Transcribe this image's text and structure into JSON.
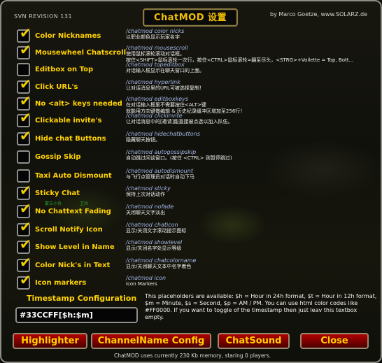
{
  "window": {
    "title": "ChatMOD 设置",
    "credit": "by Marco Goetze, www.SOLARZ.de",
    "revision": "SVN REVISION 131"
  },
  "options": [
    {
      "label": "Color Nicknames",
      "checked": true,
      "cmd": "/chatmod color nicks",
      "desc": "以职业颜色显示玩家名字"
    },
    {
      "label": "Mousewheel Chatscroll",
      "checked": true,
      "cmd": "/chatmod mousescroll",
      "desc": "使用鼠标滚轮滚动对话框。\n按住<SHIFT>鼠标滚轮一次行，按住<CTRL>鼠标滚轮=翻至尽头，<STRG>+Voilette = Top, Bott..."
    },
    {
      "label": "Editbox on Top",
      "checked": false,
      "cmd": "/chatmod topeditbox",
      "desc": "对话输入框显示在聊天窗口的上面。"
    },
    {
      "label": "Click URL's",
      "checked": true,
      "cmd": "/chatmod hyperlink",
      "desc": "让对话消息里的URL可被选择复制！"
    },
    {
      "label": "No <alt> keys needed",
      "checked": true,
      "cmd": "/chatmod editboxkeys",
      "desc": "在对话输入框里不需要按住<ALT>键\n就能用方向键做编辑 & 历史纪录缓冲区增加至256行！"
    },
    {
      "label": "Clickable invite's",
      "checked": true,
      "cmd": "/chatmod clickinvite",
      "desc": "让对话消息中的[邀请]能直接被点选以加入队伍。"
    },
    {
      "label": "Hide chat Buttons",
      "checked": true,
      "cmd": "/chatmod hidechatbuttons",
      "desc": "隐藏聊天按钮。"
    },
    {
      "label": "Gossip Skip",
      "checked": false,
      "cmd": "/chatmod autogossipskip",
      "desc": "自动跳过闲谈窗口。(按住 <CTRL> 则暂停跳过)"
    },
    {
      "label": "Taxi Auto Dismount",
      "checked": false,
      "cmd": "/chatmod autodismount",
      "desc": "与飞行点管理员对话时自动下马"
    },
    {
      "label": "Sticky Chat",
      "checked": true,
      "cmd": "/chatmod sticky",
      "desc": "保持上次对话动作"
    },
    {
      "label": "No Chattext Fading",
      "checked": true,
      "cmd": "/chatmod nofade",
      "desc": "关闭聊天文字淡出"
    },
    {
      "label": "Scroll Notify Icon",
      "checked": true,
      "cmd": "/chatmod chaticon",
      "desc": "显示/关闭文字滚动提示图标"
    },
    {
      "label": "Show Level in Name",
      "checked": true,
      "cmd": "/chatmod showlevel",
      "desc": "显示/关闭名字处显示等级"
    },
    {
      "label": "Color Nick's in Text",
      "checked": true,
      "cmd": "/chatmod chatcolorname",
      "desc": "显示/关闭聊天文本中名字着色"
    },
    {
      "label": "Icon markers",
      "checked": true,
      "cmd": "/chatmod icon",
      "desc": "Icon Markers"
    }
  ],
  "tiny_labels": [
    "蒙古小兵",
    "卫兵"
  ],
  "timestamp": {
    "title": "Timestamp Configuration",
    "value": "#33CCFF[$h:$m]",
    "help": "This placeholders are available: $h = Hour in 24h format, $t = Hour in 12h format, $m = Minute, $s = Second, $p = AM / PM. You can use html color codes like #FF0000. If you want to toggle of the timestamp then just leav this textbox empty."
  },
  "buttons": {
    "highlighter": "Highlighter",
    "channelname": "ChannelName Config",
    "chatsound": "ChatSound",
    "close": "Close"
  },
  "footer": "ChatMOD uses currently 230 Kb memory, staring 0 players.",
  "colors": {
    "label": "#ffd200",
    "command": "#a5b8e8",
    "description": "#f0f0f0",
    "button_bg": "#9a0000",
    "title": "#f2c100"
  }
}
